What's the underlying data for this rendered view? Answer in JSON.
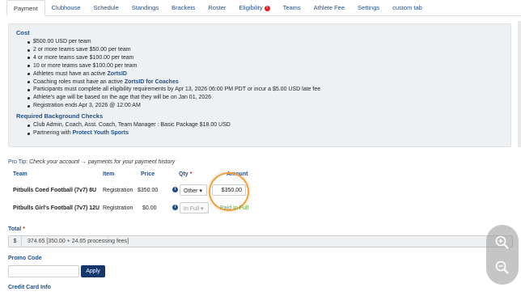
{
  "tabs": [
    {
      "label": "Payment",
      "active": true
    },
    {
      "label": "Clubhouse"
    },
    {
      "label": "Schedule"
    },
    {
      "label": "Standings"
    },
    {
      "label": "Brackets"
    },
    {
      "label": "Roster"
    },
    {
      "label": "Eligibility",
      "alert": "!"
    },
    {
      "label": "Teams"
    },
    {
      "label": "Athlete Fee"
    },
    {
      "label": "Settings"
    },
    {
      "label": "custom tab"
    }
  ],
  "info": {
    "cost_heading": "Cost",
    "cost_items": [
      "$500.00 USD per team",
      "2 or more teams save $50.00 per team",
      "4 or more teams save $100.00 per team",
      "10 or more teams save $100.00 per team",
      "Athletes must have an active ",
      "Coaching roles must have an active ",
      "Participants must complete all eligibility requirements by Apr 13, 2026 06:00 PM PDT or incur a $5.00 USD late fee",
      "Athlete's age will be based on the age that they will be on Jan 01, 2026",
      "Registration ends Apr 3, 2026 @ 12:00 AM"
    ],
    "zortsid_link": "ZortsID",
    "zortsid_coaches_link": "ZortsID for Coaches",
    "bg_heading": "Required Background Checks",
    "bg_items": [
      "Club Admin, Coach, Asst. Coach, Team Manager : Basic Package $18.00 USD",
      "Partnering with "
    ],
    "pys_link": "Protect Youth Sports"
  },
  "protip": {
    "label": "Pro Tip:",
    "text": "Check your account → payments for your payment history"
  },
  "table": {
    "headers": {
      "team": "Team",
      "item": "Item",
      "price": "Price",
      "qty": "Qty",
      "qty_req": "*",
      "amount": "Amount"
    },
    "rows": [
      {
        "team": "Pitbulls Coed Football (7v7) 8U",
        "item": "Registration",
        "price": "$350.00",
        "qty": "Other",
        "amount": "$350.00"
      },
      {
        "team": "Pitbulls Girl's Football (7v7) 12U",
        "item": "Registration",
        "price": "$0.00",
        "qty": "In Full",
        "amount": "Paid In Full"
      }
    ]
  },
  "total": {
    "label": "Total",
    "required": "*",
    "prefix": "$",
    "value": "374.65 [350.00 + 24.65 processing fees]"
  },
  "promo": {
    "label": "Promo Code",
    "placeholder": "",
    "apply": "Apply"
  },
  "credit_card": {
    "label": "Credit Card Info"
  },
  "colors": {
    "link": "#1f4e8c",
    "button": "#16376d",
    "highlight": "#f0a040",
    "paid": "#5aa02c",
    "alert": "#e02020"
  }
}
